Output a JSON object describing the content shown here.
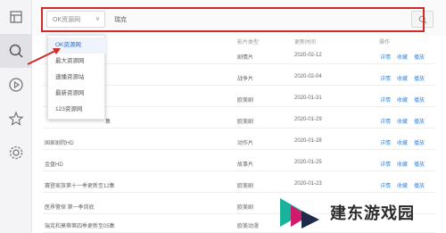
{
  "search": {
    "source_selected": "OK资源网",
    "query": "瑞克",
    "dropdown_options": [
      "OK资源网",
      "最大资源网",
      "速播资源站",
      "最新资源网",
      "123资源网"
    ]
  },
  "table": {
    "headers": [
      "影片类型",
      "更新时间",
      "操作"
    ],
    "rows": [
      {
        "title": "",
        "type": "剧情片",
        "date": "2020-02-12"
      },
      {
        "title": "",
        "type": "战争片",
        "date": "2020-02-04"
      },
      {
        "title": "",
        "type": "欧美剧",
        "date": "2020-01-31"
      },
      {
        "title": "集",
        "type": "欧美剧",
        "date": "2020-01-29"
      },
      {
        "title": "国家剧院HD",
        "type": "动作片",
        "date": "2020-01-28"
      },
      {
        "title": "金盘HD",
        "type": "故事片",
        "date": "2020-01-25"
      },
      {
        "title": "赛登家族第十一季更新至12集",
        "type": "欧美剧",
        "date": "2020-01-23"
      },
      {
        "title": "医界警探 第一季岗底",
        "type": "欧美剧",
        "date": ""
      },
      {
        "title": "瑞克和莫蒂第四季更新至05集",
        "type": "欧美动漫",
        "date": ""
      }
    ],
    "actions": [
      "详情",
      "收藏",
      "播放"
    ]
  },
  "watermark": {
    "text": "建东游戏园"
  },
  "colors": {
    "highlight": "#d12a2a",
    "link": "#2d8cf0",
    "selected_option": "#2d6cd6"
  }
}
